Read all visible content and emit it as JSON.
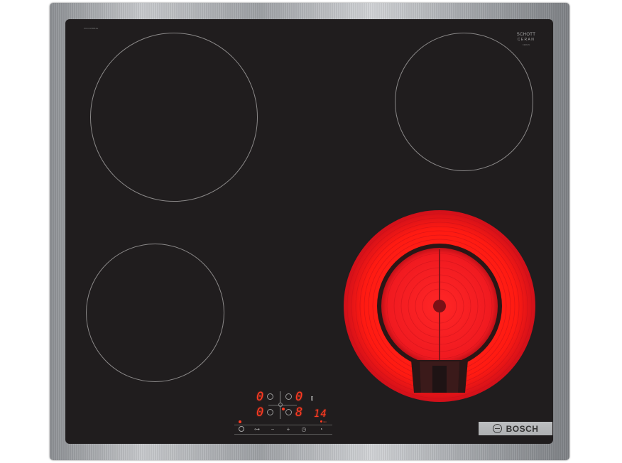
{
  "product": {
    "model_code": "PKF645BB2E",
    "glass_brand_line1": "SCHOTT",
    "glass_brand_line2": "CERAN",
    "glass_brand_line3": "CERAN",
    "brand": "BOSCH"
  },
  "colors": {
    "glass": "#201d1e",
    "frame": "#b8babd",
    "display_red": "#ff3a22",
    "heating_red": "#ff1a1a",
    "zone_outline": "#8a8888"
  },
  "zones": [
    {
      "name": "front-left",
      "state": "off"
    },
    {
      "name": "rear-left",
      "state": "off"
    },
    {
      "name": "rear-right",
      "state": "off"
    },
    {
      "name": "front-right",
      "state": "on",
      "type": "dual-circuit"
    }
  ],
  "display": {
    "rear_left_level": "0",
    "rear_right_level": "0",
    "front_left_level": "0",
    "front_right_level": "8",
    "timer_value": "14"
  },
  "controls": {
    "power_icon": "power-icon",
    "childlock_icon": "key-icon",
    "minus_label": "−",
    "plus_label": "+",
    "timer_icon": "timer-icon",
    "clock_icon": "clock-icon",
    "info_label": "min"
  }
}
